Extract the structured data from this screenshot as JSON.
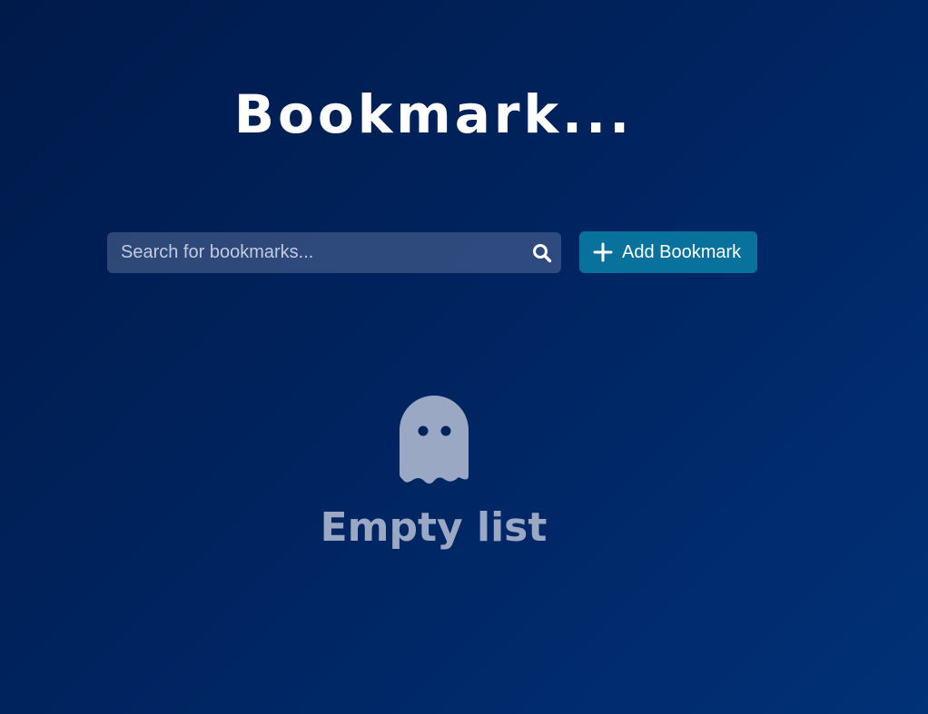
{
  "header": {
    "title": "Bookmark..."
  },
  "search": {
    "placeholder": "Search for bookmarks...",
    "value": "",
    "icon": "search-icon"
  },
  "toolbar": {
    "add_label": "Add Bookmark",
    "add_icon": "plus-icon"
  },
  "empty_state": {
    "icon": "ghost-icon",
    "label": "Empty list"
  },
  "colors": {
    "background_start": "#001a4a",
    "background_end": "#013177",
    "accent": "#08729c",
    "muted_text": "#9aa8c4"
  }
}
